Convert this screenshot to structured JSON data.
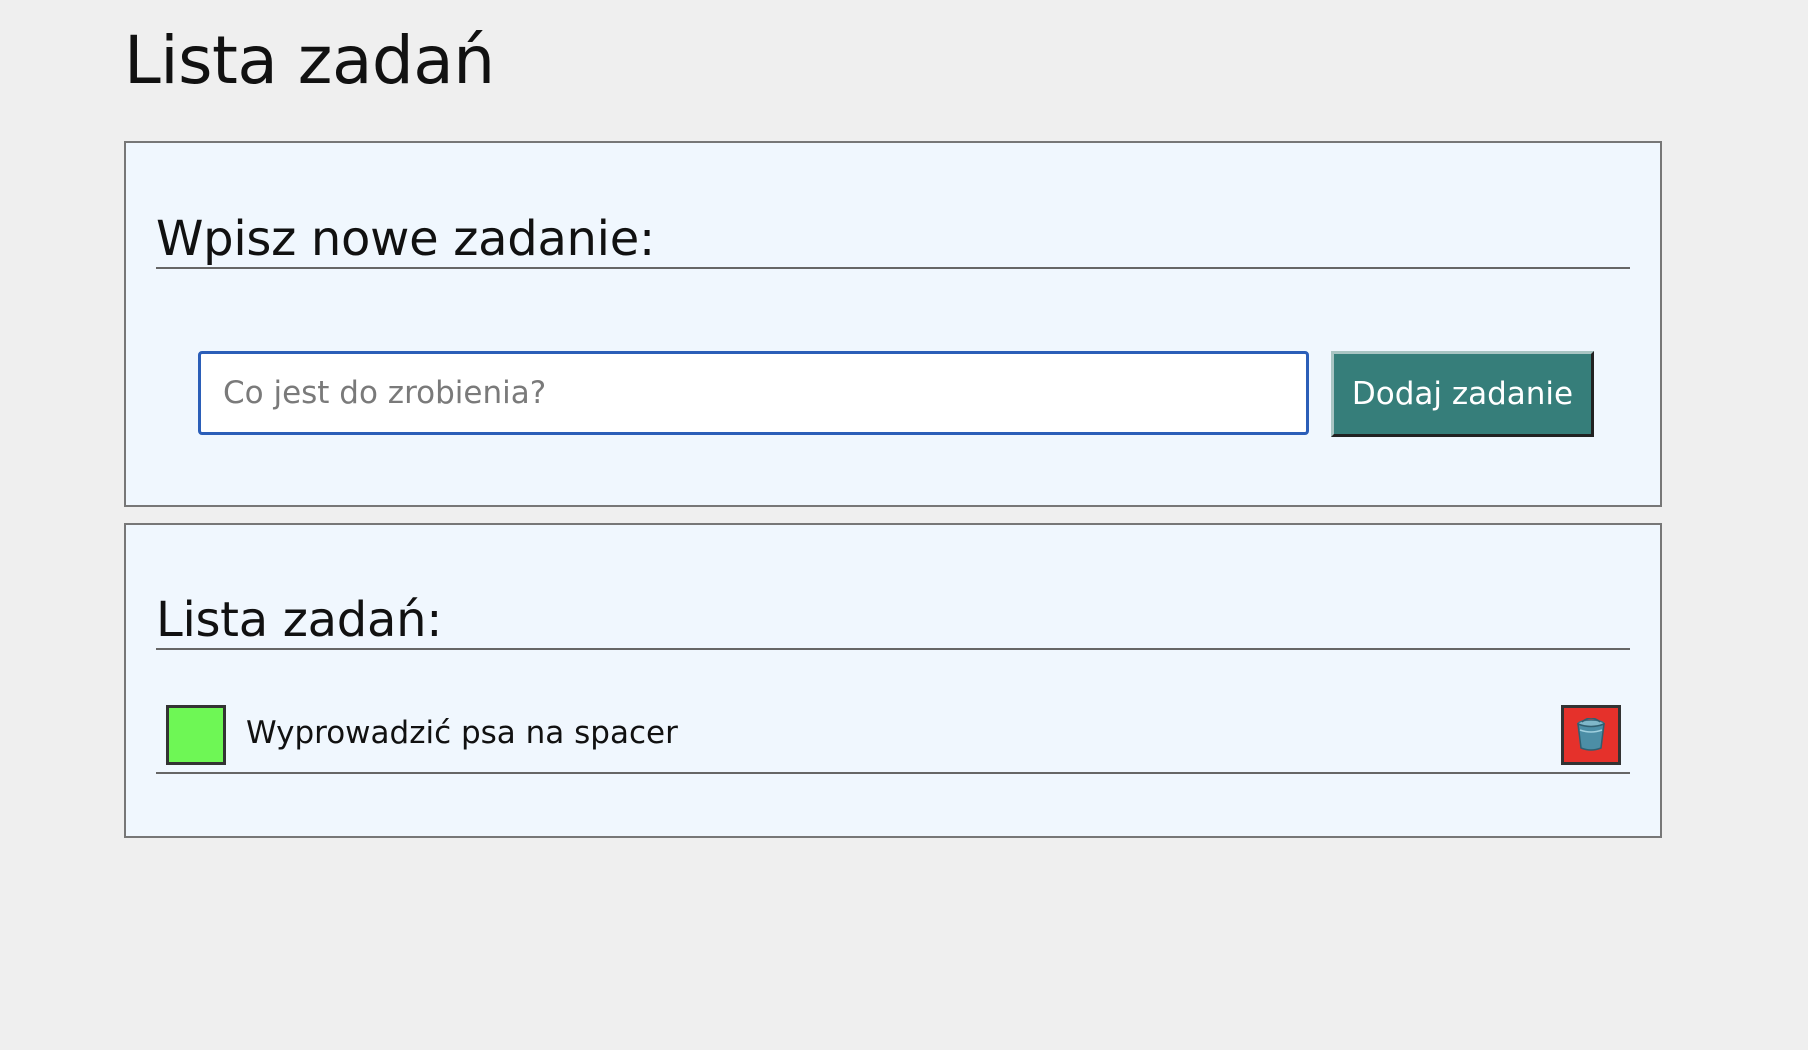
{
  "page": {
    "title": "Lista zadań"
  },
  "new_task": {
    "heading": "Wpisz nowe zadanie:",
    "input_placeholder": "Co jest do zrobienia?",
    "input_value": "",
    "add_button_label": "Dodaj zadanie"
  },
  "task_list": {
    "heading": "Lista zadań:",
    "items": [
      {
        "text": "Wyprowadzić psa na spacer",
        "check_icon": "checkbox-square",
        "delete_icon": "bucket-icon"
      }
    ]
  },
  "colors": {
    "page_background": "#efefef",
    "panel_background": "#f0f7fe",
    "input_border": "#2b5eb8",
    "add_button": "#367e7a",
    "check_box": "#6ef755",
    "delete_button": "#e5312b"
  }
}
